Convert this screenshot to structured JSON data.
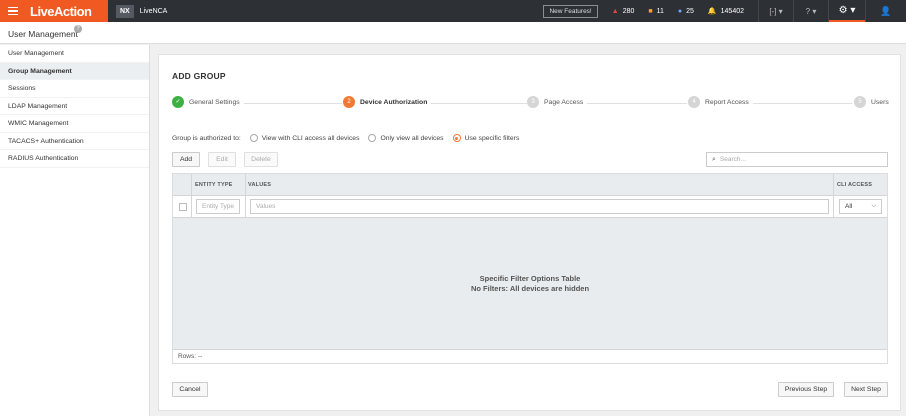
{
  "topbar": {
    "brand": "LiveAction",
    "nx_badge": "NX",
    "product": "LiveNCA",
    "new_features": "New Features!",
    "stats": [
      {
        "icon": "triangle-alert-icon",
        "value": "280",
        "color": "#e8443a"
      },
      {
        "icon": "square-warning-icon",
        "value": "11",
        "color": "#f5a623"
      },
      {
        "icon": "circle-info-icon",
        "value": "25",
        "color": "#6ea8ff"
      },
      {
        "icon": "bell-icon",
        "value": "145402",
        "color": "#6ea8ff"
      }
    ]
  },
  "page": {
    "title": "User Management"
  },
  "sidebar": {
    "items": [
      {
        "label": "User Management",
        "active": false
      },
      {
        "label": "Group Management",
        "active": true
      },
      {
        "label": "Sessions",
        "active": false
      },
      {
        "label": "LDAP Management",
        "active": false
      },
      {
        "label": "WMIC Management",
        "active": false
      },
      {
        "label": "TACACS+ Authentication",
        "active": false
      },
      {
        "label": "RADIUS Authentication",
        "active": false
      }
    ]
  },
  "card": {
    "title": "ADD GROUP",
    "steps": [
      {
        "num": "1",
        "label": "General Settings",
        "state": "done"
      },
      {
        "num": "2",
        "label": "Device Authorization",
        "state": "current"
      },
      {
        "num": "3",
        "label": "Page Access",
        "state": "todo"
      },
      {
        "num": "4",
        "label": "Report Access",
        "state": "todo"
      },
      {
        "num": "5",
        "label": "Users",
        "state": "todo"
      }
    ],
    "auth_label": "Group is authorized to:",
    "auth_options": [
      {
        "label": "View with CLI access all devices",
        "selected": false
      },
      {
        "label": "Only view all devices",
        "selected": false
      },
      {
        "label": "Use specific filters",
        "selected": true
      }
    ],
    "actions": {
      "add": "Add",
      "edit": "Edit",
      "delete": "Delete"
    },
    "search_placeholder": "Search...",
    "table": {
      "columns": {
        "entity_type": "ENTITY TYPE",
        "values": "VALUES",
        "cli_access": "CLI ACCESS"
      },
      "filter": {
        "entity_placeholder": "Entity Type",
        "values_placeholder": "Values",
        "cli_value": "All"
      },
      "empty_title": "Specific Filter Options Table",
      "empty_subtitle": "No Filters: All devices are hidden",
      "rows_label": "Rows: --"
    },
    "footer": {
      "cancel": "Cancel",
      "previous": "Previous Step",
      "next": "Next Step"
    }
  },
  "colors": {
    "brand": "#f05a22",
    "done": "#3cb043",
    "current": "#f07a33"
  }
}
